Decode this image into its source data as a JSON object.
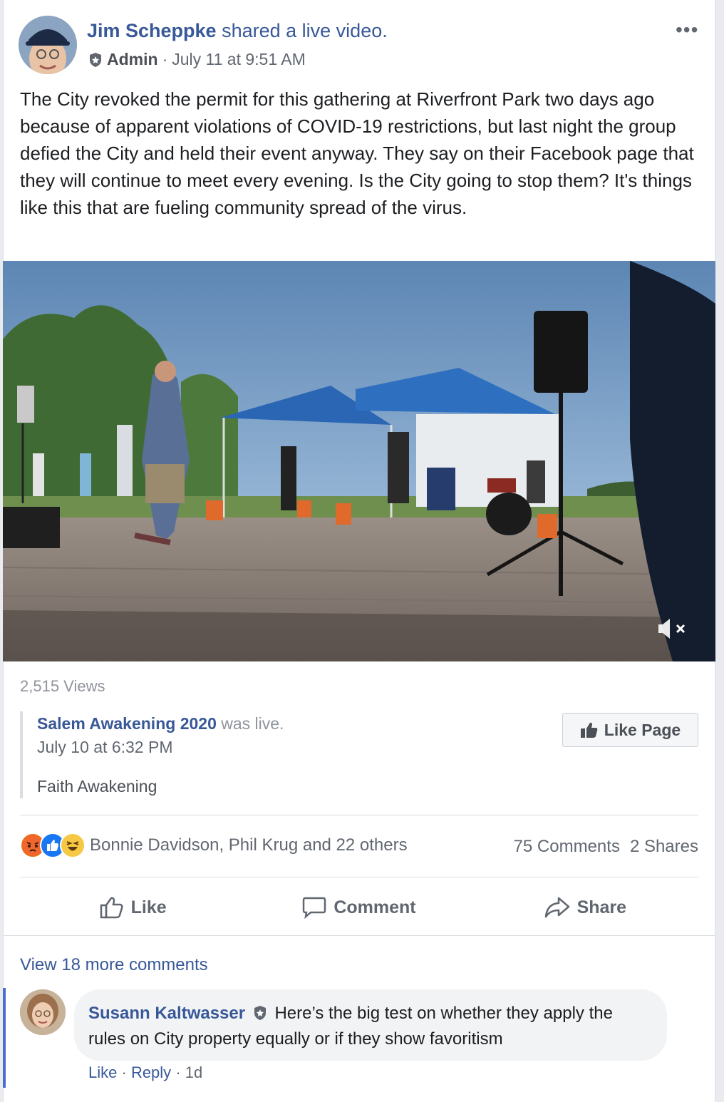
{
  "post": {
    "author": "Jim Scheppke",
    "action": "shared a live video.",
    "role": "Admin",
    "timestamp": "July 11 at 9:51 AM",
    "text": "The City revoked the permit for this gathering at Riverfront Park two days ago because of apparent violations of COVID-19 restrictions, but last night the group defied the City and held their event anyway. They say on their Facebook page that they will continue to meet every evening. Is the City going to stop them? It's things like this that are fueling community spread of the virus."
  },
  "video": {
    "views": "2,515 Views",
    "muted": true
  },
  "shared_source": {
    "page_name": "Salem Awakening 2020",
    "status": "was live.",
    "date": "July 10 at 6:32 PM",
    "description": "Faith Awakening",
    "like_page_label": "Like Page"
  },
  "engagement": {
    "reactions": [
      "angry",
      "like",
      "haha"
    ],
    "reaction_names": "Bonnie Davidson, Phil Krug and 22 others",
    "comments": "75 Comments",
    "shares": "2 Shares"
  },
  "actions": {
    "like": "Like",
    "comment": "Comment",
    "share": "Share"
  },
  "comments": {
    "view_more": "View 18 more comments",
    "items": [
      {
        "author": "Susann Kaltwasser",
        "text": "Here’s the big test on whether they apply the rules on City property equally or if they show favoritism",
        "like": "Like",
        "reply": "Reply",
        "age": "1d"
      }
    ]
  },
  "colors": {
    "link_blue": "#385898",
    "meta_gray": "#616770",
    "accent_bar": "#4b6fcf"
  }
}
